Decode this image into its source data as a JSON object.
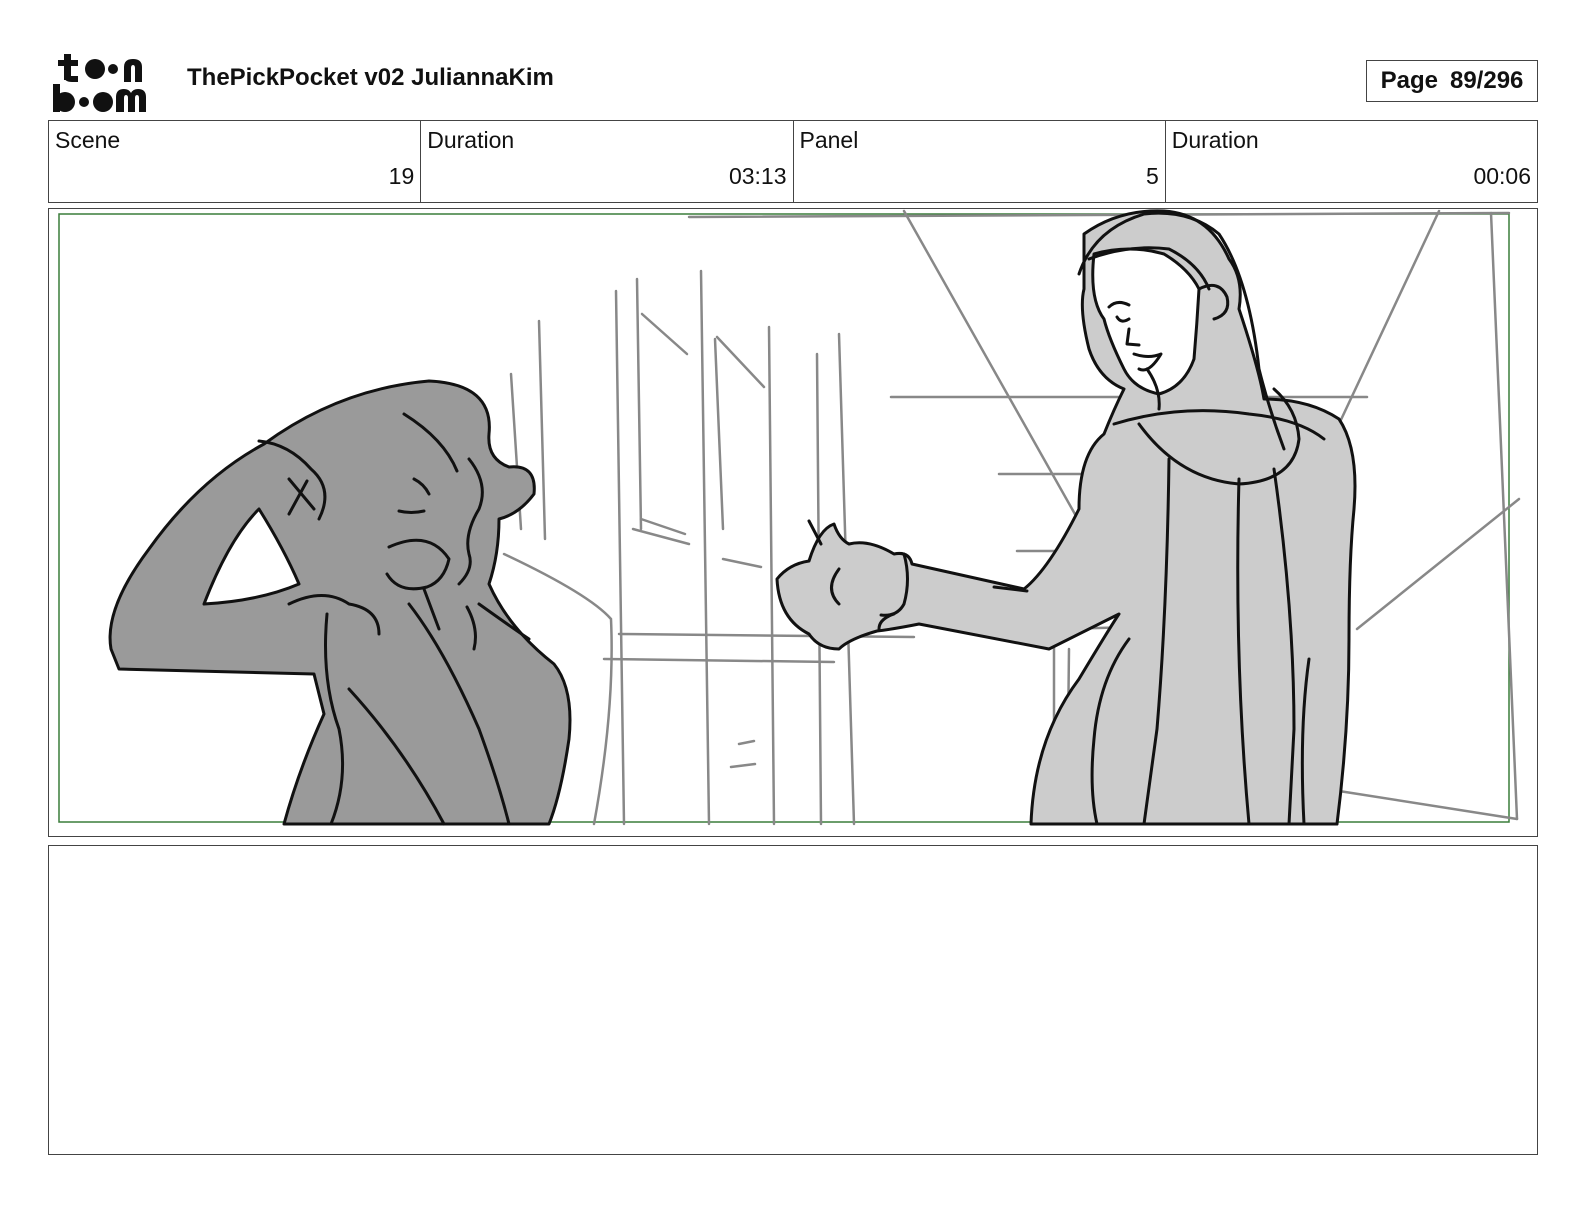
{
  "header": {
    "logo_text": "toon boom",
    "doc_title": "ThePickPocket v02 JuliannaKim",
    "page_label": "Page",
    "page_value": "89/296"
  },
  "info": {
    "scene_label": "Scene",
    "scene_value": "19",
    "scene_duration_label": "Duration",
    "scene_duration_value": "03:13",
    "panel_label": "Panel",
    "panel_value": "5",
    "panel_duration_label": "Duration",
    "panel_duration_value": "00:06"
  },
  "colors": {
    "frame_border": "#444444",
    "safe_area": "#3a7d3a",
    "dark_fill": "#9a9a9a",
    "light_fill": "#cccccc",
    "sketch_line": "#888888",
    "ink": "#111111"
  },
  "icons": [
    "toon-boom-logo"
  ]
}
